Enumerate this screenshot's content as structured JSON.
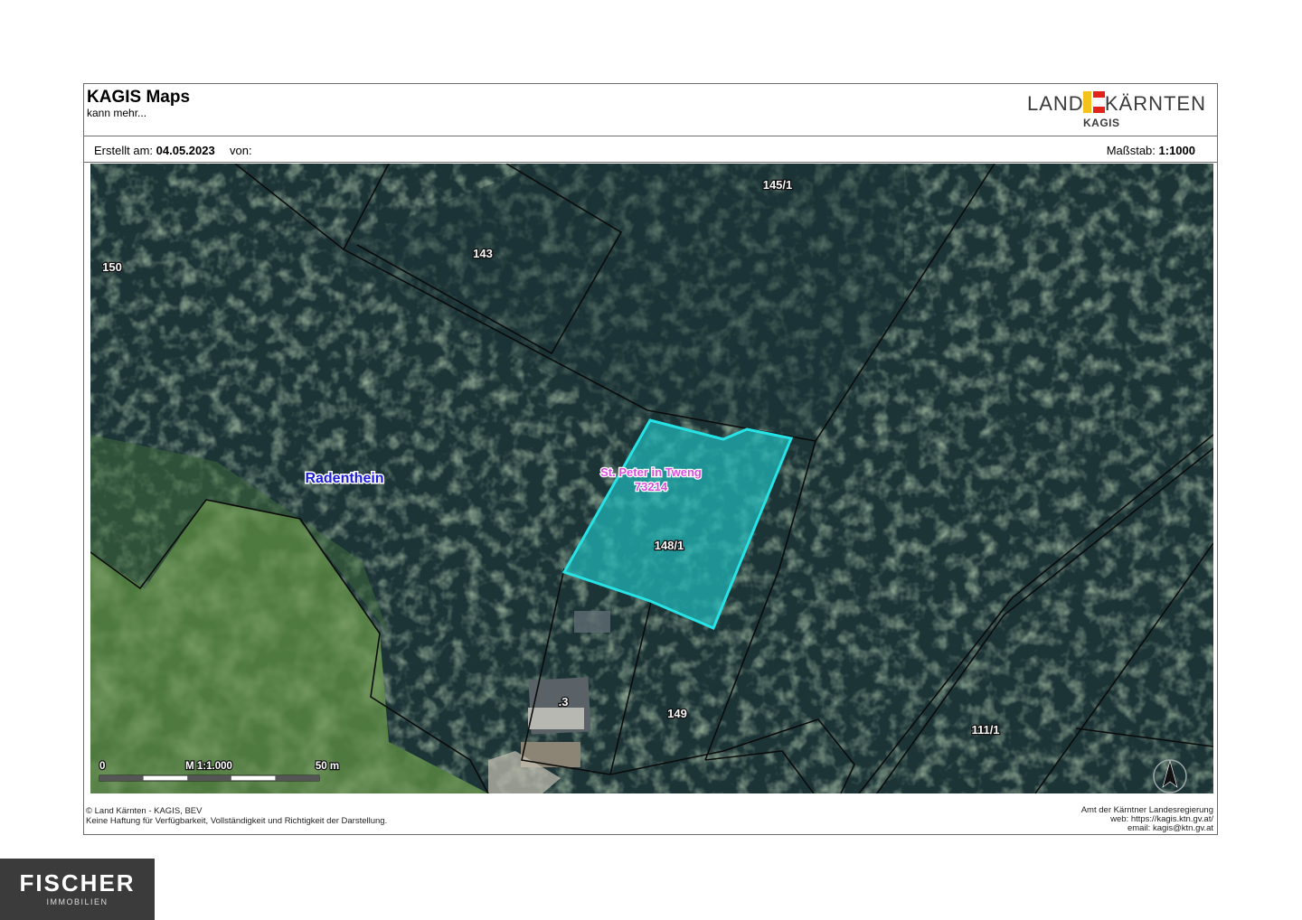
{
  "header": {
    "title": "KAGIS Maps",
    "subtitle": "kann mehr...",
    "logo_left": "LAND",
    "logo_right": "KÄRNTEN",
    "logo_sub": "KAGIS"
  },
  "infobar": {
    "created_label": "Erstellt am:",
    "created_date": "04.05.2023",
    "from_label": "von:",
    "scale_label": "Maßstab:",
    "scale_value": "1:1000"
  },
  "map": {
    "parcels": {
      "p145_1": "145/1",
      "p143": "143",
      "p150": "150",
      "p148_1": "148/1",
      "p3": ".3",
      "p149": "149",
      "p111_1": "111/1"
    },
    "municipality_west": "Radenthein",
    "cadastral_name": "St. Peter in Tweng",
    "cadastral_code": "73214",
    "scalebar": {
      "start": "0",
      "label": "M 1:1.000",
      "end": "50 m"
    }
  },
  "footer": {
    "left_line1": "© Land Kärnten - KAGIS, BEV",
    "left_line2": "Keine Haftung für Verfügbarkeit, Vollständigkeit und Richtigkeit der Darstellung.",
    "right_line1": "Amt der Kärntner Landesregierung",
    "right_line2": "web: https://kagis.ktn.gv.at/",
    "right_line3": "email: kagis@ktn.gv.at"
  },
  "brand": {
    "name": "FISCHER",
    "sub": "IMMOBILIEN"
  },
  "colors": {
    "highlight_fill": "#1fb7b9",
    "highlight_stroke": "#26e3e6",
    "municipality_label": "#1c1cd6",
    "cadastral_label": "#d84fe0"
  }
}
